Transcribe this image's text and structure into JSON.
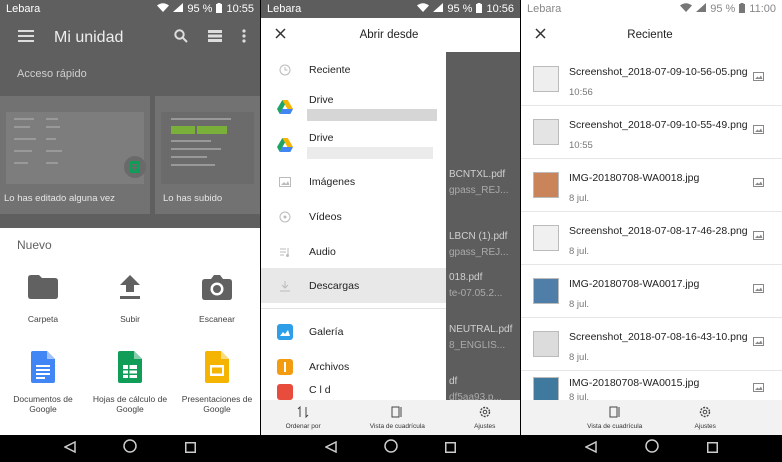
{
  "status": {
    "carrier": "Lebara",
    "battery": "95 %",
    "time1": "10:55",
    "time2": "10:56",
    "time3": "11:00"
  },
  "drive": {
    "title": "Mi unidad",
    "quick_access": "Acceso rápido",
    "card1_caption": "Lo has editado alguna vez",
    "card2_caption": "Lo has subido",
    "sheet_title": "Nuevo",
    "actions": [
      {
        "label": "Carpeta"
      },
      {
        "label": "Subir"
      },
      {
        "label": "Escanear"
      },
      {
        "label": "Documentos de Google"
      },
      {
        "label": "Hojas de cálculo de Google"
      },
      {
        "label": "Presentaciones de Google"
      }
    ]
  },
  "open_from": {
    "title": "Abrir desde",
    "menu": [
      {
        "label": "Reciente"
      },
      {
        "label": "Drive"
      },
      {
        "label": "Drive"
      },
      {
        "label": "Imágenes"
      },
      {
        "label": "Vídeos"
      },
      {
        "label": "Audio"
      },
      {
        "label": "Descargas"
      },
      {
        "label": "Galería"
      },
      {
        "label": "Archivos"
      },
      {
        "label": "C l d"
      }
    ],
    "behind_files": [
      "BCNTXL.pdf",
      "gpass_REJ...",
      "LBCN (1).pdf",
      "gpass_REJ...",
      "018.pdf",
      "te-07.05.2...",
      "NEUTRAL.pdf",
      "8_ENGLIS...",
      "df",
      "df5aa93.p..."
    ],
    "bottom": {
      "sort": "Ordenar por",
      "grid": "Vista de cuadrícula",
      "settings": "Ajustes"
    }
  },
  "recent": {
    "title": "Reciente",
    "files": [
      {
        "name": "Screenshot_2018-07-09-10-56-05.png",
        "date": "10:56"
      },
      {
        "name": "Screenshot_2018-07-09-10-55-49.png",
        "date": "10:55"
      },
      {
        "name": "IMG-20180708-WA0018.jpg",
        "date": "8 jul."
      },
      {
        "name": "Screenshot_2018-07-08-17-46-28.png",
        "date": "8 jul."
      },
      {
        "name": "IMG-20180708-WA0017.jpg",
        "date": "8 jul."
      },
      {
        "name": "Screenshot_2018-07-08-16-43-10.png",
        "date": "8 jul."
      },
      {
        "name": "IMG-20180708-WA0015.jpg",
        "date": "8 jul."
      }
    ],
    "bottom": {
      "grid": "Vista de cuadrícula",
      "settings": "Ajustes"
    }
  },
  "colors": {
    "docs_blue": "#4285f4",
    "sheets_green": "#0f9d58",
    "slides_yellow": "#f4b400",
    "drive_green": "#1fa463",
    "icon_grey": "#616161"
  }
}
